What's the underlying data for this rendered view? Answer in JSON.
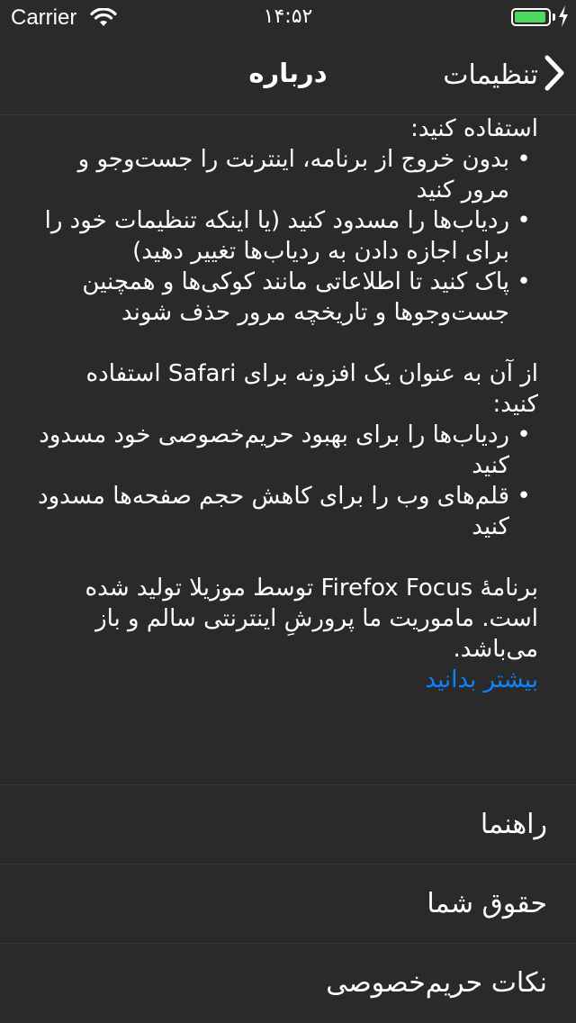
{
  "status_bar": {
    "carrier": "Carrier",
    "time": "۱۴:۵۲",
    "battery_level": 1.0
  },
  "nav": {
    "title": "درباره",
    "back_label": "تنظیمات"
  },
  "content": {
    "intro": "استفاده کنید:",
    "app_bullets": [
      "بدون خروج از برنامه، اینترنت را جست‌وجو و مرور کنید",
      "ردیاب‌ها را مسدود کنید (یا اینکه تنظیمات خود را برای اجازه دادن به ردیاب‌ها تغییر دهید)",
      "پاک کنید تا اطلاعاتی مانند کوکی‌ها و همچنین جست‌وجوها و تاریخچه مرور حذف شوند"
    ],
    "safari_intro": "از آن به عنوان یک افزونه برای Safari استفاده کنید:",
    "safari_bullets": [
      "ردیاب‌ها را برای بهبود حریم‌خصوصی خود مسدود کنید",
      "قلم‌های وب را برای کاهش حجم صفحه‌ها مسدود کنید"
    ],
    "mozilla_text": "برنامهٔ Firefox Focus توسط موزیلا تولید شده است. ماموریت ما پرورشِ اینترنتی سالم و باز می‌باشد.",
    "learn_more": "بیشتر بدانید"
  },
  "menu": {
    "items": [
      {
        "label": "راهنما"
      },
      {
        "label": "حقوق شما"
      },
      {
        "label": "نکات حریم‌خصوصی"
      }
    ]
  },
  "colors": {
    "background": "#2a2a2a",
    "link": "#0a84ff",
    "battery": "#4cd964"
  }
}
